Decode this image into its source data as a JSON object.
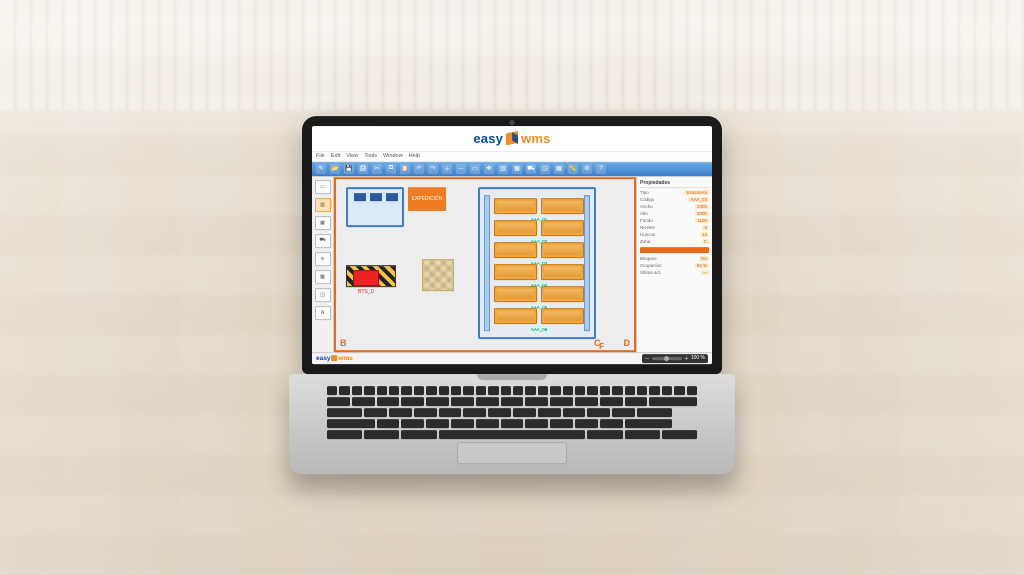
{
  "brand": {
    "part1": "easy",
    "part2": "wms"
  },
  "menubar": {
    "items": [
      "File",
      "Edit",
      "View",
      "Tools",
      "Window",
      "Help"
    ]
  },
  "toolbar": {
    "icons": [
      "new",
      "open",
      "save",
      "print",
      "cut",
      "copy",
      "paste",
      "undo",
      "redo",
      "zoom-in",
      "zoom-out",
      "select",
      "move",
      "rack",
      "pallet",
      "dock",
      "zone",
      "grid",
      "measure",
      "settings",
      "help"
    ]
  },
  "palette": {
    "items": [
      "select",
      "rack",
      "pallet",
      "dock",
      "conveyor",
      "buffer",
      "zone",
      "label"
    ]
  },
  "canvas": {
    "gate_label": "",
    "expedition_label": "EXPEDICIÓN",
    "buffer_label": "BTS_D",
    "axis": {
      "b": "B",
      "c": "C",
      "d": "D",
      "f": "F"
    },
    "rack_labels": [
      "AAA_01",
      "AAA_02",
      "AAA_03",
      "AAA_04",
      "AAA_05",
      "AAA_06"
    ]
  },
  "props": {
    "header": "Propiedades",
    "rows": [
      {
        "k": "Tipo",
        "v": "Estantería"
      },
      {
        "k": "Código",
        "v": "AAA_03"
      },
      {
        "k": "Ancho",
        "v": "2400"
      },
      {
        "k": "Alto",
        "v": "8000"
      },
      {
        "k": "Fondo",
        "v": "1100"
      },
      {
        "k": "Niveles",
        "v": "6"
      },
      {
        "k": "Huecos",
        "v": "12"
      },
      {
        "k": "Zona",
        "v": "C"
      },
      {
        "k": "Color",
        "v": "#E66B1F"
      },
      {
        "k": "Bloqueo",
        "v": "No"
      },
      {
        "k": "Ocupación",
        "v": "83 %"
      },
      {
        "k": "Última act.",
        "v": "—"
      }
    ]
  },
  "status": {
    "zoom_pct": "100 %"
  }
}
